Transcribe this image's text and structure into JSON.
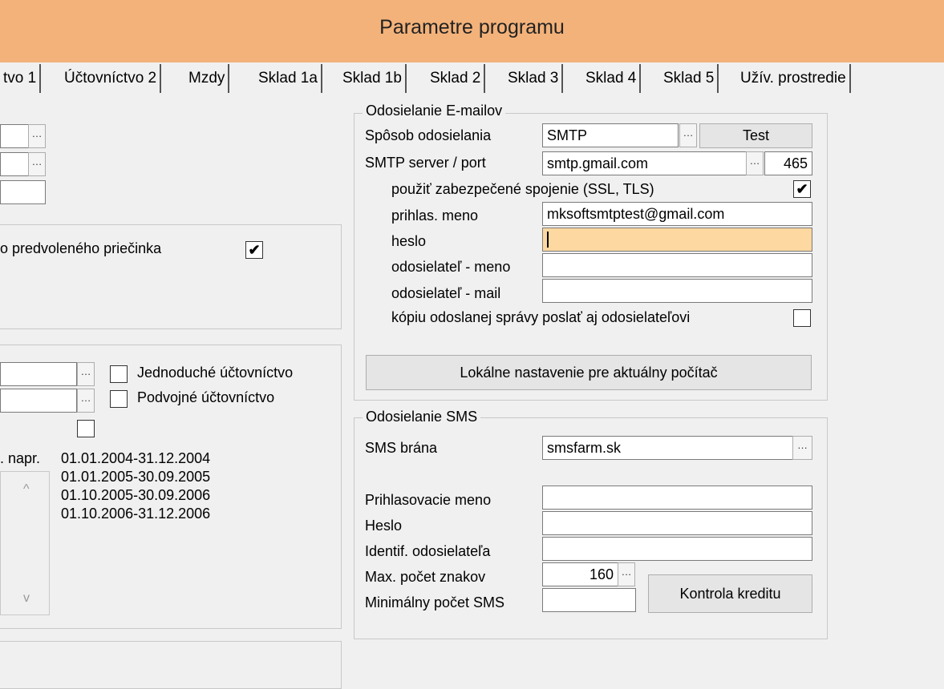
{
  "window": {
    "title": "Parametre programu"
  },
  "tabs": [
    "tvo 1",
    "Účtovníctvo 2",
    "Mzdy",
    "Sklad 1a",
    "Sklad 1b",
    "Sklad 2",
    "Sklad 3",
    "Sklad 4",
    "Sklad 5",
    "Užív. prostredie"
  ],
  "left": {
    "folder_label": "o predvoleného priečinka",
    "accounting": {
      "simple": "Jednoduché účtovníctvo",
      "double": "Podvojné účtovníctvo"
    },
    "periods_prefix": ". napr.",
    "periods": [
      "01.01.2004-31.12.2004",
      "01.01.2005-30.09.2005",
      "01.10.2005-30.09.2006",
      "01.10.2006-31.12.2006"
    ]
  },
  "email": {
    "legend": "Odosielanie E-mailov",
    "method_label": "Spôsob odosielania",
    "method_value": "SMTP",
    "test_button": "Test",
    "server_label": "SMTP server / port",
    "server_value": "smtp.gmail.com",
    "port_value": "465",
    "ssl_label": "použiť zabezpečené spojenie (SSL, TLS)",
    "login_label": "prihlas. meno",
    "login_value": "mksoftsmtptest@gmail.com",
    "password_label": "heslo",
    "sender_name_label": "odosielateľ - meno",
    "sender_mail_label": "odosielateľ - mail",
    "copy_label": "kópiu odoslanej správy poslať aj odosielateľovi",
    "local_button": "Lokálne nastavenie pre aktuálny počítač"
  },
  "sms": {
    "legend": "Odosielanie SMS",
    "gateway_label": "SMS brána",
    "gateway_value": "smsfarm.sk",
    "login_label": "Prihlasovacie meno",
    "password_label": "Heslo",
    "sender_label": "Identif. odosielateľa",
    "max_label": "Max. počet znakov",
    "max_value": "160",
    "min_label": "Minimálny počet SMS",
    "credit_button": "Kontrola kreditu"
  },
  "icons": {
    "ellipsis": "…",
    "check": "✔",
    "scroll_up": "^",
    "scroll_down": "v"
  }
}
